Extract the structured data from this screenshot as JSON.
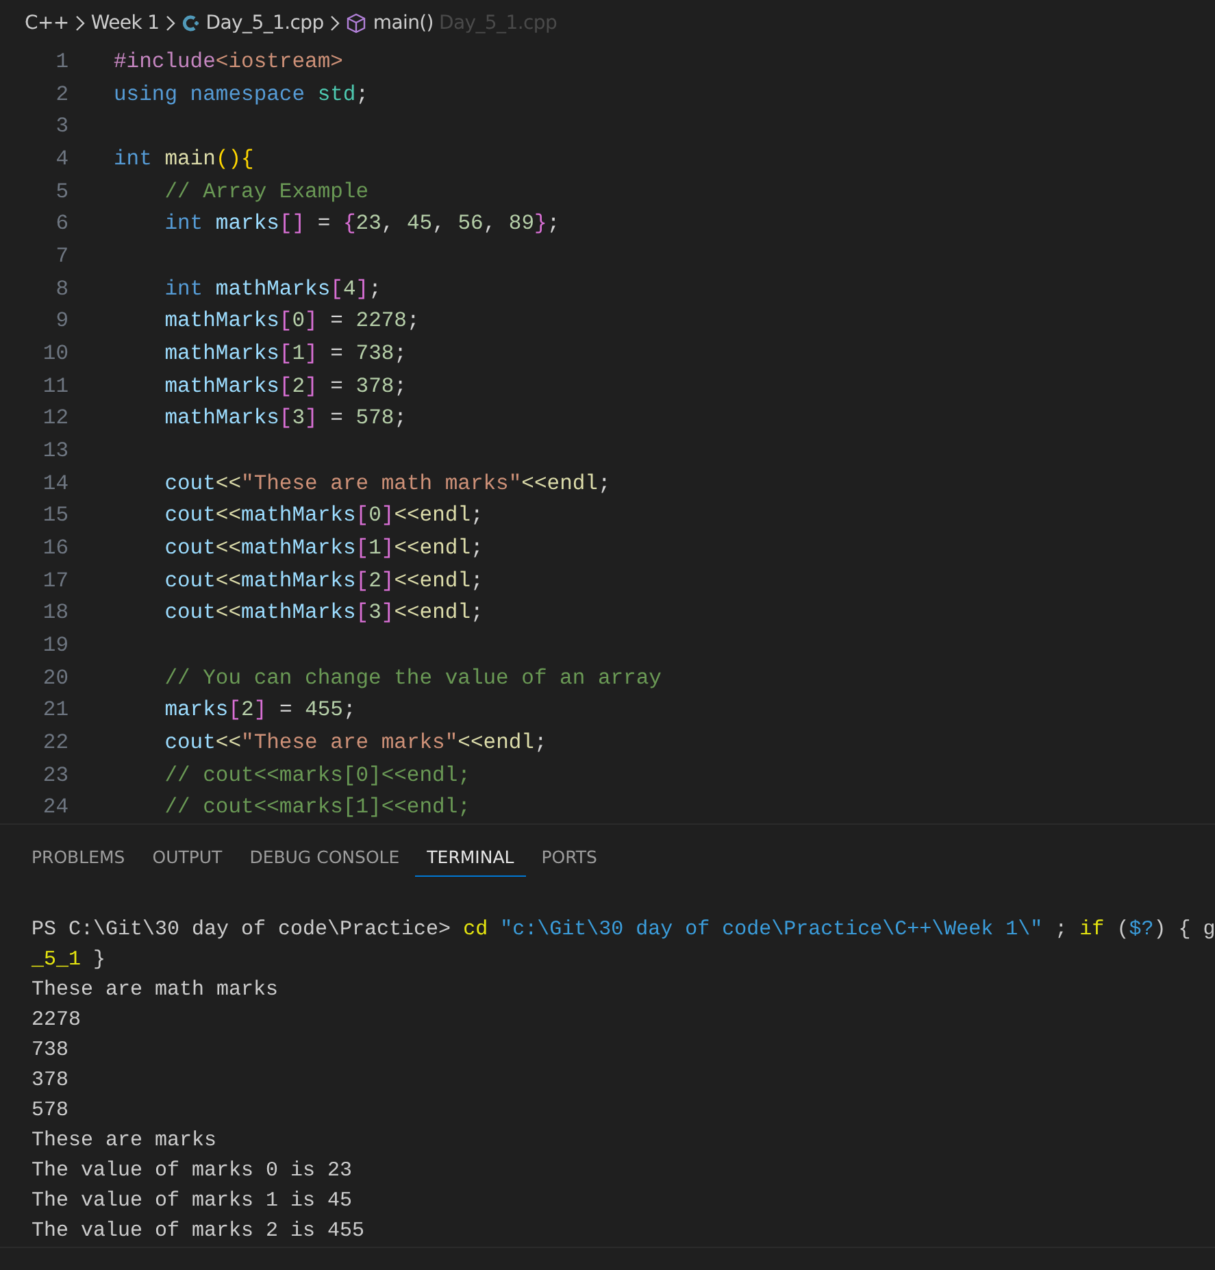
{
  "breadcrumb": [
    {
      "kind": "folder",
      "label": "C++"
    },
    {
      "kind": "folder",
      "label": "Week 1"
    },
    {
      "kind": "file",
      "label": "Day_5_1.cpp"
    },
    {
      "kind": "symbol",
      "label": "main()"
    },
    {
      "kind": "ghost",
      "label": "Day_5_1.cpp"
    }
  ],
  "editor": {
    "lines": [
      {
        "number": "1",
        "tokens": [
          {
            "kind": "directive",
            "text": "#include"
          },
          {
            "kind": "string",
            "text": "<iostream>"
          }
        ]
      },
      {
        "number": "2",
        "tokens": [
          {
            "kind": "keyword",
            "text": "using namespace "
          },
          {
            "kind": "type",
            "text": "std"
          },
          {
            "kind": "plain",
            "text": ";"
          }
        ]
      },
      {
        "number": "3"
      },
      {
        "number": "4",
        "tokens": [
          {
            "kind": "keyword",
            "text": "int "
          },
          {
            "kind": "function",
            "text": "main"
          },
          {
            "kind": "bracket1",
            "text": "(){"
          }
        ]
      },
      {
        "number": "5",
        "tokens": [
          {
            "kind": "comment",
            "text": "    // Array Example"
          }
        ]
      },
      {
        "number": "6",
        "tokens": [
          {
            "kind": "keyword",
            "text": "    int "
          },
          {
            "kind": "variable",
            "text": "marks"
          },
          {
            "kind": "bracket2",
            "text": "[]"
          },
          {
            "kind": "plain",
            "text": " = "
          },
          {
            "kind": "bracket2",
            "text": "{"
          },
          {
            "kind": "number",
            "text": "23"
          },
          {
            "kind": "plain",
            "text": ", "
          },
          {
            "kind": "number",
            "text": "45"
          },
          {
            "kind": "plain",
            "text": ", "
          },
          {
            "kind": "number",
            "text": "56"
          },
          {
            "kind": "plain",
            "text": ", "
          },
          {
            "kind": "number",
            "text": "89"
          },
          {
            "kind": "bracket2",
            "text": "}"
          },
          {
            "kind": "plain",
            "text": ";"
          }
        ]
      },
      {
        "number": "7"
      },
      {
        "number": "8",
        "tokens": [
          {
            "kind": "keyword",
            "text": "    int "
          },
          {
            "kind": "variable",
            "text": "mathMarks"
          },
          {
            "kind": "bracket2",
            "text": "["
          },
          {
            "kind": "number",
            "text": "4"
          },
          {
            "kind": "bracket2",
            "text": "]"
          },
          {
            "kind": "plain",
            "text": ";"
          }
        ]
      },
      {
        "number": "9",
        "tokens": [
          {
            "kind": "variable",
            "text": "    mathMarks"
          },
          {
            "kind": "bracket2",
            "text": "["
          },
          {
            "kind": "number",
            "text": "0"
          },
          {
            "kind": "bracket2",
            "text": "]"
          },
          {
            "kind": "plain",
            "text": " = "
          },
          {
            "kind": "number",
            "text": "2278"
          },
          {
            "kind": "plain",
            "text": ";"
          }
        ]
      },
      {
        "number": "10",
        "tokens": [
          {
            "kind": "variable",
            "text": "    mathMarks"
          },
          {
            "kind": "bracket2",
            "text": "["
          },
          {
            "kind": "number",
            "text": "1"
          },
          {
            "kind": "bracket2",
            "text": "]"
          },
          {
            "kind": "plain",
            "text": " = "
          },
          {
            "kind": "number",
            "text": "738"
          },
          {
            "kind": "plain",
            "text": ";"
          }
        ]
      },
      {
        "number": "11",
        "tokens": [
          {
            "kind": "variable",
            "text": "    mathMarks"
          },
          {
            "kind": "bracket2",
            "text": "["
          },
          {
            "kind": "number",
            "text": "2"
          },
          {
            "kind": "bracket2",
            "text": "]"
          },
          {
            "kind": "plain",
            "text": " = "
          },
          {
            "kind": "number",
            "text": "378"
          },
          {
            "kind": "plain",
            "text": ";"
          }
        ]
      },
      {
        "number": "12",
        "tokens": [
          {
            "kind": "variable",
            "text": "    mathMarks"
          },
          {
            "kind": "bracket2",
            "text": "["
          },
          {
            "kind": "number",
            "text": "3"
          },
          {
            "kind": "bracket2",
            "text": "]"
          },
          {
            "kind": "plain",
            "text": " = "
          },
          {
            "kind": "number",
            "text": "578"
          },
          {
            "kind": "plain",
            "text": ";"
          }
        ]
      },
      {
        "number": "13"
      },
      {
        "number": "14",
        "tokens": [
          {
            "kind": "variable",
            "text": "    cout"
          },
          {
            "kind": "function",
            "text": "<<"
          },
          {
            "kind": "string",
            "text": "\"These are math marks\""
          },
          {
            "kind": "function",
            "text": "<<endl"
          },
          {
            "kind": "plain",
            "text": ";"
          }
        ]
      },
      {
        "number": "15",
        "tokens": [
          {
            "kind": "variable",
            "text": "    cout"
          },
          {
            "kind": "function",
            "text": "<<"
          },
          {
            "kind": "variable",
            "text": "mathMarks"
          },
          {
            "kind": "bracket2",
            "text": "["
          },
          {
            "kind": "number",
            "text": "0"
          },
          {
            "kind": "bracket2",
            "text": "]"
          },
          {
            "kind": "function",
            "text": "<<endl"
          },
          {
            "kind": "plain",
            "text": ";"
          }
        ]
      },
      {
        "number": "16",
        "tokens": [
          {
            "kind": "variable",
            "text": "    cout"
          },
          {
            "kind": "function",
            "text": "<<"
          },
          {
            "kind": "variable",
            "text": "mathMarks"
          },
          {
            "kind": "bracket2",
            "text": "["
          },
          {
            "kind": "number",
            "text": "1"
          },
          {
            "kind": "bracket2",
            "text": "]"
          },
          {
            "kind": "function",
            "text": "<<endl"
          },
          {
            "kind": "plain",
            "text": ";"
          }
        ]
      },
      {
        "number": "17",
        "tokens": [
          {
            "kind": "variable",
            "text": "    cout"
          },
          {
            "kind": "function",
            "text": "<<"
          },
          {
            "kind": "variable",
            "text": "mathMarks"
          },
          {
            "kind": "bracket2",
            "text": "["
          },
          {
            "kind": "number",
            "text": "2"
          },
          {
            "kind": "bracket2",
            "text": "]"
          },
          {
            "kind": "function",
            "text": "<<endl"
          },
          {
            "kind": "plain",
            "text": ";"
          }
        ]
      },
      {
        "number": "18",
        "tokens": [
          {
            "kind": "variable",
            "text": "    cout"
          },
          {
            "kind": "function",
            "text": "<<"
          },
          {
            "kind": "variable",
            "text": "mathMarks"
          },
          {
            "kind": "bracket2",
            "text": "["
          },
          {
            "kind": "number",
            "text": "3"
          },
          {
            "kind": "bracket2",
            "text": "]"
          },
          {
            "kind": "function",
            "text": "<<endl"
          },
          {
            "kind": "plain",
            "text": ";"
          }
        ]
      },
      {
        "number": "19"
      },
      {
        "number": "20",
        "tokens": [
          {
            "kind": "comment",
            "text": "    // You can change the value of an array"
          }
        ]
      },
      {
        "number": "21",
        "tokens": [
          {
            "kind": "variable",
            "text": "    marks"
          },
          {
            "kind": "bracket2",
            "text": "["
          },
          {
            "kind": "number",
            "text": "2"
          },
          {
            "kind": "bracket2",
            "text": "]"
          },
          {
            "kind": "plain",
            "text": " = "
          },
          {
            "kind": "number",
            "text": "455"
          },
          {
            "kind": "plain",
            "text": ";"
          }
        ]
      },
      {
        "number": "22",
        "tokens": [
          {
            "kind": "variable",
            "text": "    cout"
          },
          {
            "kind": "function",
            "text": "<<"
          },
          {
            "kind": "string",
            "text": "\"These are marks\""
          },
          {
            "kind": "function",
            "text": "<<endl"
          },
          {
            "kind": "plain",
            "text": ";"
          }
        ]
      },
      {
        "number": "23",
        "tokens": [
          {
            "kind": "comment",
            "text": "    // cout<<marks[0]<<endl;"
          }
        ]
      },
      {
        "number": "24",
        "tokens": [
          {
            "kind": "comment",
            "text": "    // cout<<marks[1]<<endl;"
          }
        ]
      }
    ]
  },
  "panel": {
    "tabs": [
      {
        "label": "PROBLEMS",
        "selected": false
      },
      {
        "label": "OUTPUT",
        "selected": false
      },
      {
        "label": "DEBUG CONSOLE",
        "selected": false
      },
      {
        "label": "TERMINAL",
        "selected": true
      },
      {
        "label": "PORTS",
        "selected": false
      }
    ],
    "terminal": [
      {
        "tokens": [
          {
            "kind": "plain",
            "text": "PS C:\\Git\\30 day of code\\Practice> "
          },
          {
            "kind": "command",
            "text": "cd"
          },
          {
            "kind": "string",
            "text": " \"c:\\Git\\30 day of code\\Practice\\C++\\Week 1\\\""
          },
          {
            "kind": "plain",
            "text": " ; "
          },
          {
            "kind": "command",
            "text": "if"
          },
          {
            "kind": "plain",
            "text": " ("
          },
          {
            "kind": "string",
            "text": "$?"
          },
          {
            "kind": "plain",
            "text": ") { g"
          }
        ]
      },
      {
        "tokens": [
          {
            "kind": "command",
            "text": "_5_1"
          },
          {
            "kind": "plain",
            "text": " }"
          }
        ]
      },
      {
        "tokens": [
          {
            "kind": "plain",
            "text": "These are math marks"
          }
        ]
      },
      {
        "tokens": [
          {
            "kind": "plain",
            "text": "2278"
          }
        ]
      },
      {
        "tokens": [
          {
            "kind": "plain",
            "text": "738"
          }
        ]
      },
      {
        "tokens": [
          {
            "kind": "plain",
            "text": "378"
          }
        ]
      },
      {
        "tokens": [
          {
            "kind": "plain",
            "text": "578"
          }
        ]
      },
      {
        "tokens": [
          {
            "kind": "plain",
            "text": "These are marks"
          }
        ]
      },
      {
        "tokens": [
          {
            "kind": "plain",
            "text": "The value of marks 0 is 23"
          }
        ]
      },
      {
        "tokens": [
          {
            "kind": "plain",
            "text": "The value of marks 1 is 45"
          }
        ]
      },
      {
        "tokens": [
          {
            "kind": "plain",
            "text": "The value of marks 2 is 455"
          }
        ]
      }
    ]
  }
}
